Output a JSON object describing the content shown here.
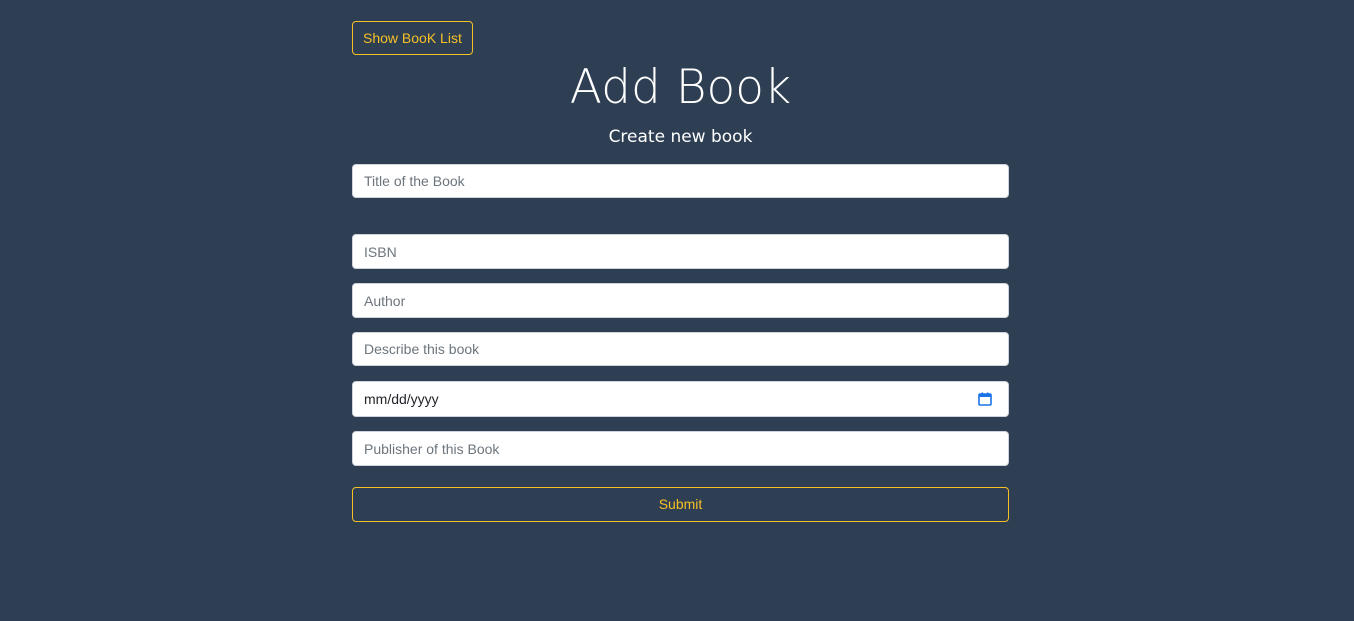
{
  "header": {
    "back_button_label": "Show BooK List",
    "title": "Add Book",
    "subtitle": "Create new book"
  },
  "form": {
    "title_placeholder": "Title of the Book",
    "isbn_placeholder": "ISBN",
    "author_placeholder": "Author",
    "description_placeholder": "Describe this book",
    "date_placeholder": "mm/dd/yyyy",
    "publisher_placeholder": "Publisher of this Book",
    "submit_label": "Submit"
  },
  "colors": {
    "background": "#2e3e53",
    "accent": "#f6c027",
    "calendar_icon": "#1a73e8"
  },
  "icons": {
    "date_picker": "calendar-icon"
  }
}
